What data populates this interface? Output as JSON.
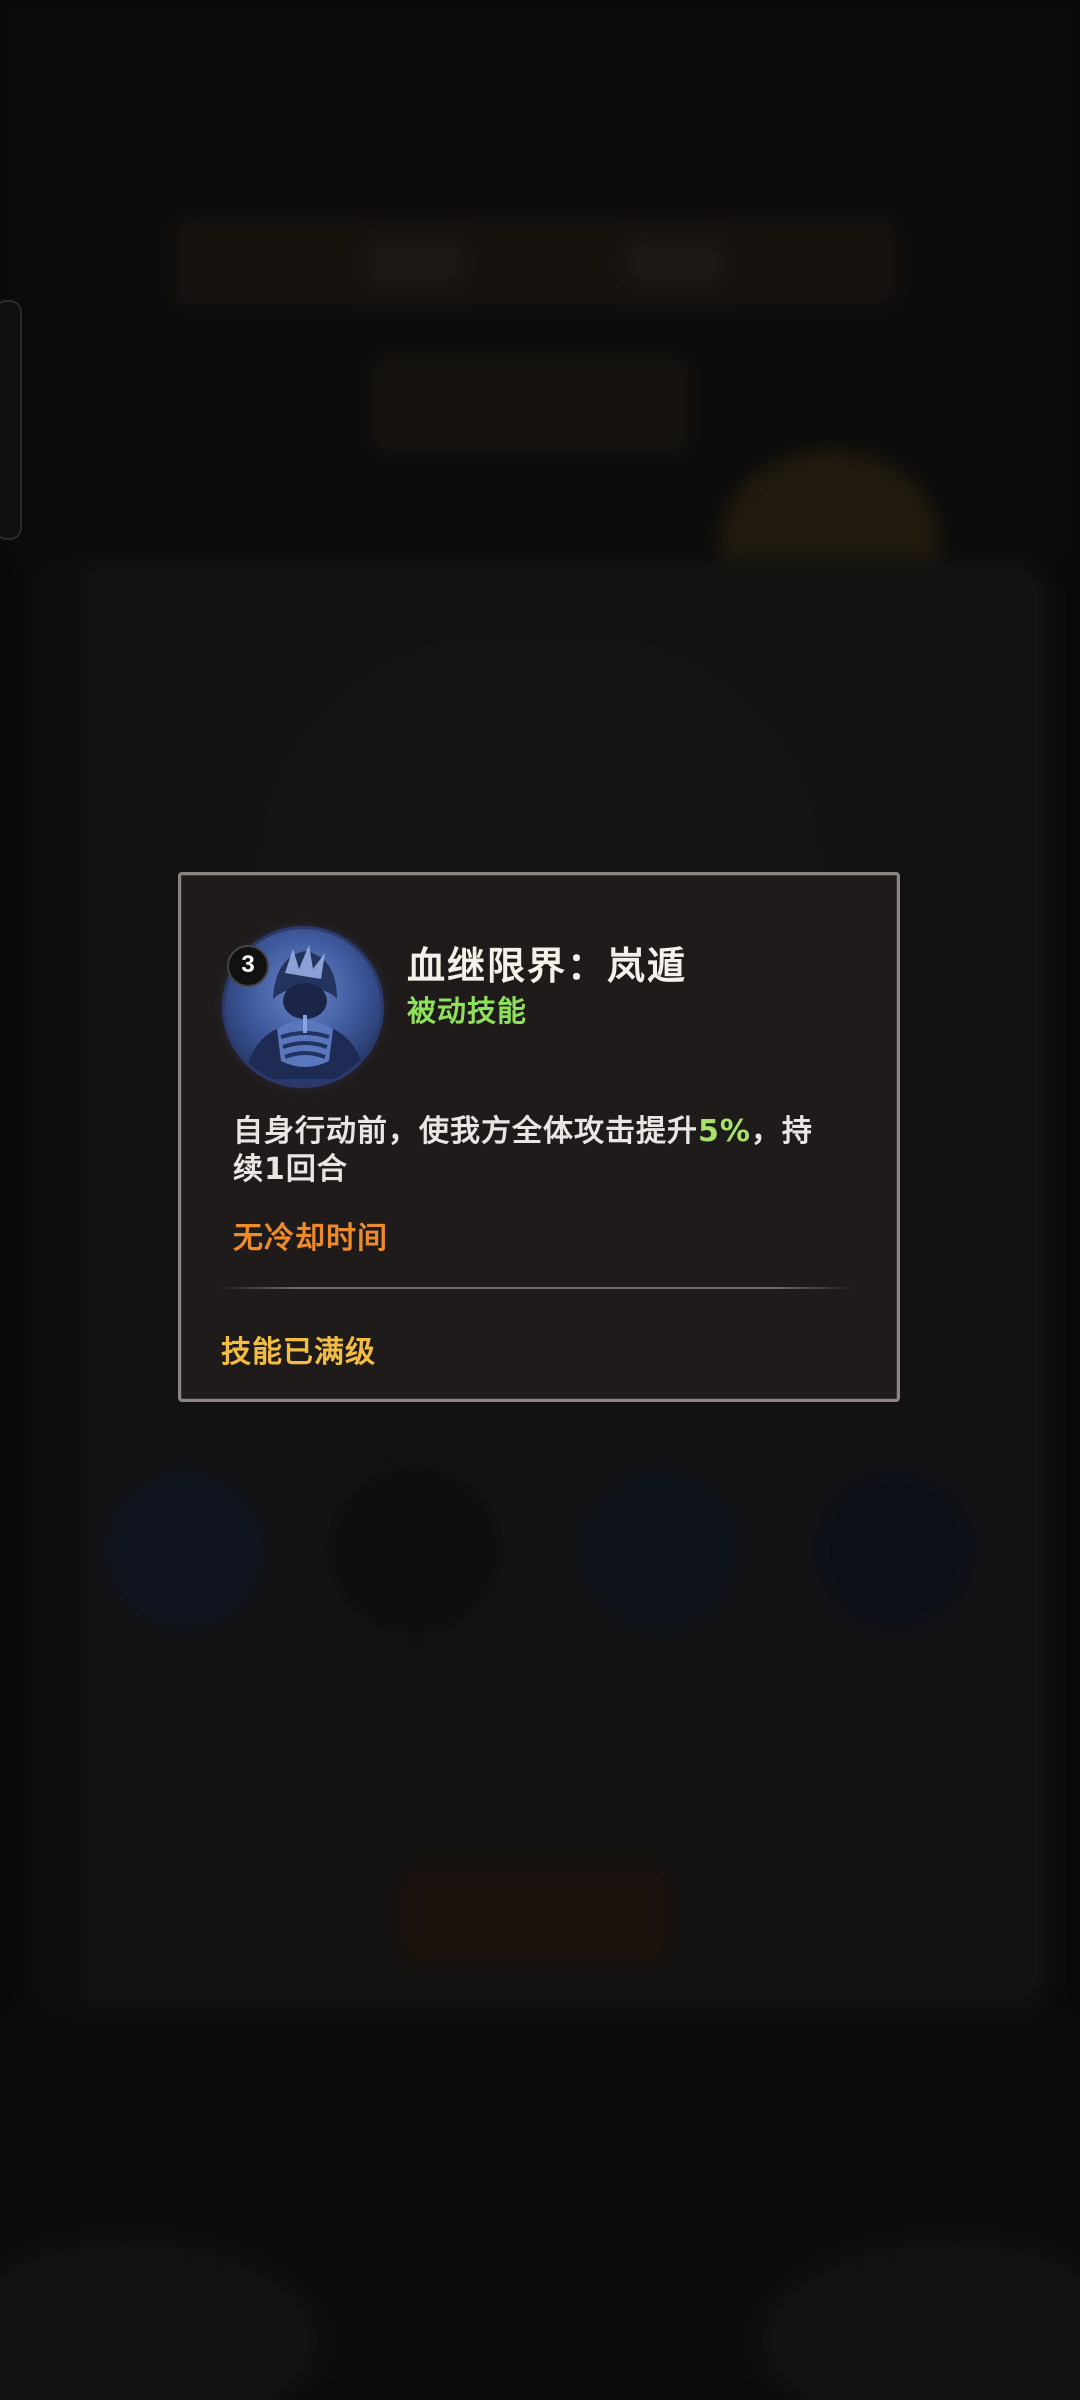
{
  "popup": {
    "skill_name": "血继限界：岚遁",
    "skill_type": "被动技能",
    "level": "3",
    "description_before": "自身行动前，使我方全体攻击提升",
    "description_highlight": "5%",
    "description_after": "，持续1回合",
    "cooldown": "无冷却时间",
    "status": "技能已满级",
    "icon": "praying-hands-figure-icon"
  },
  "colors": {
    "popup_background": "#1f1b1b",
    "popup_border": "#8b8582",
    "title": "#f4f1ea",
    "skill_type": "#8fe05a",
    "highlight": "#a8e26a",
    "cooldown": "#ec8a2c",
    "status": "#f3bd45"
  }
}
